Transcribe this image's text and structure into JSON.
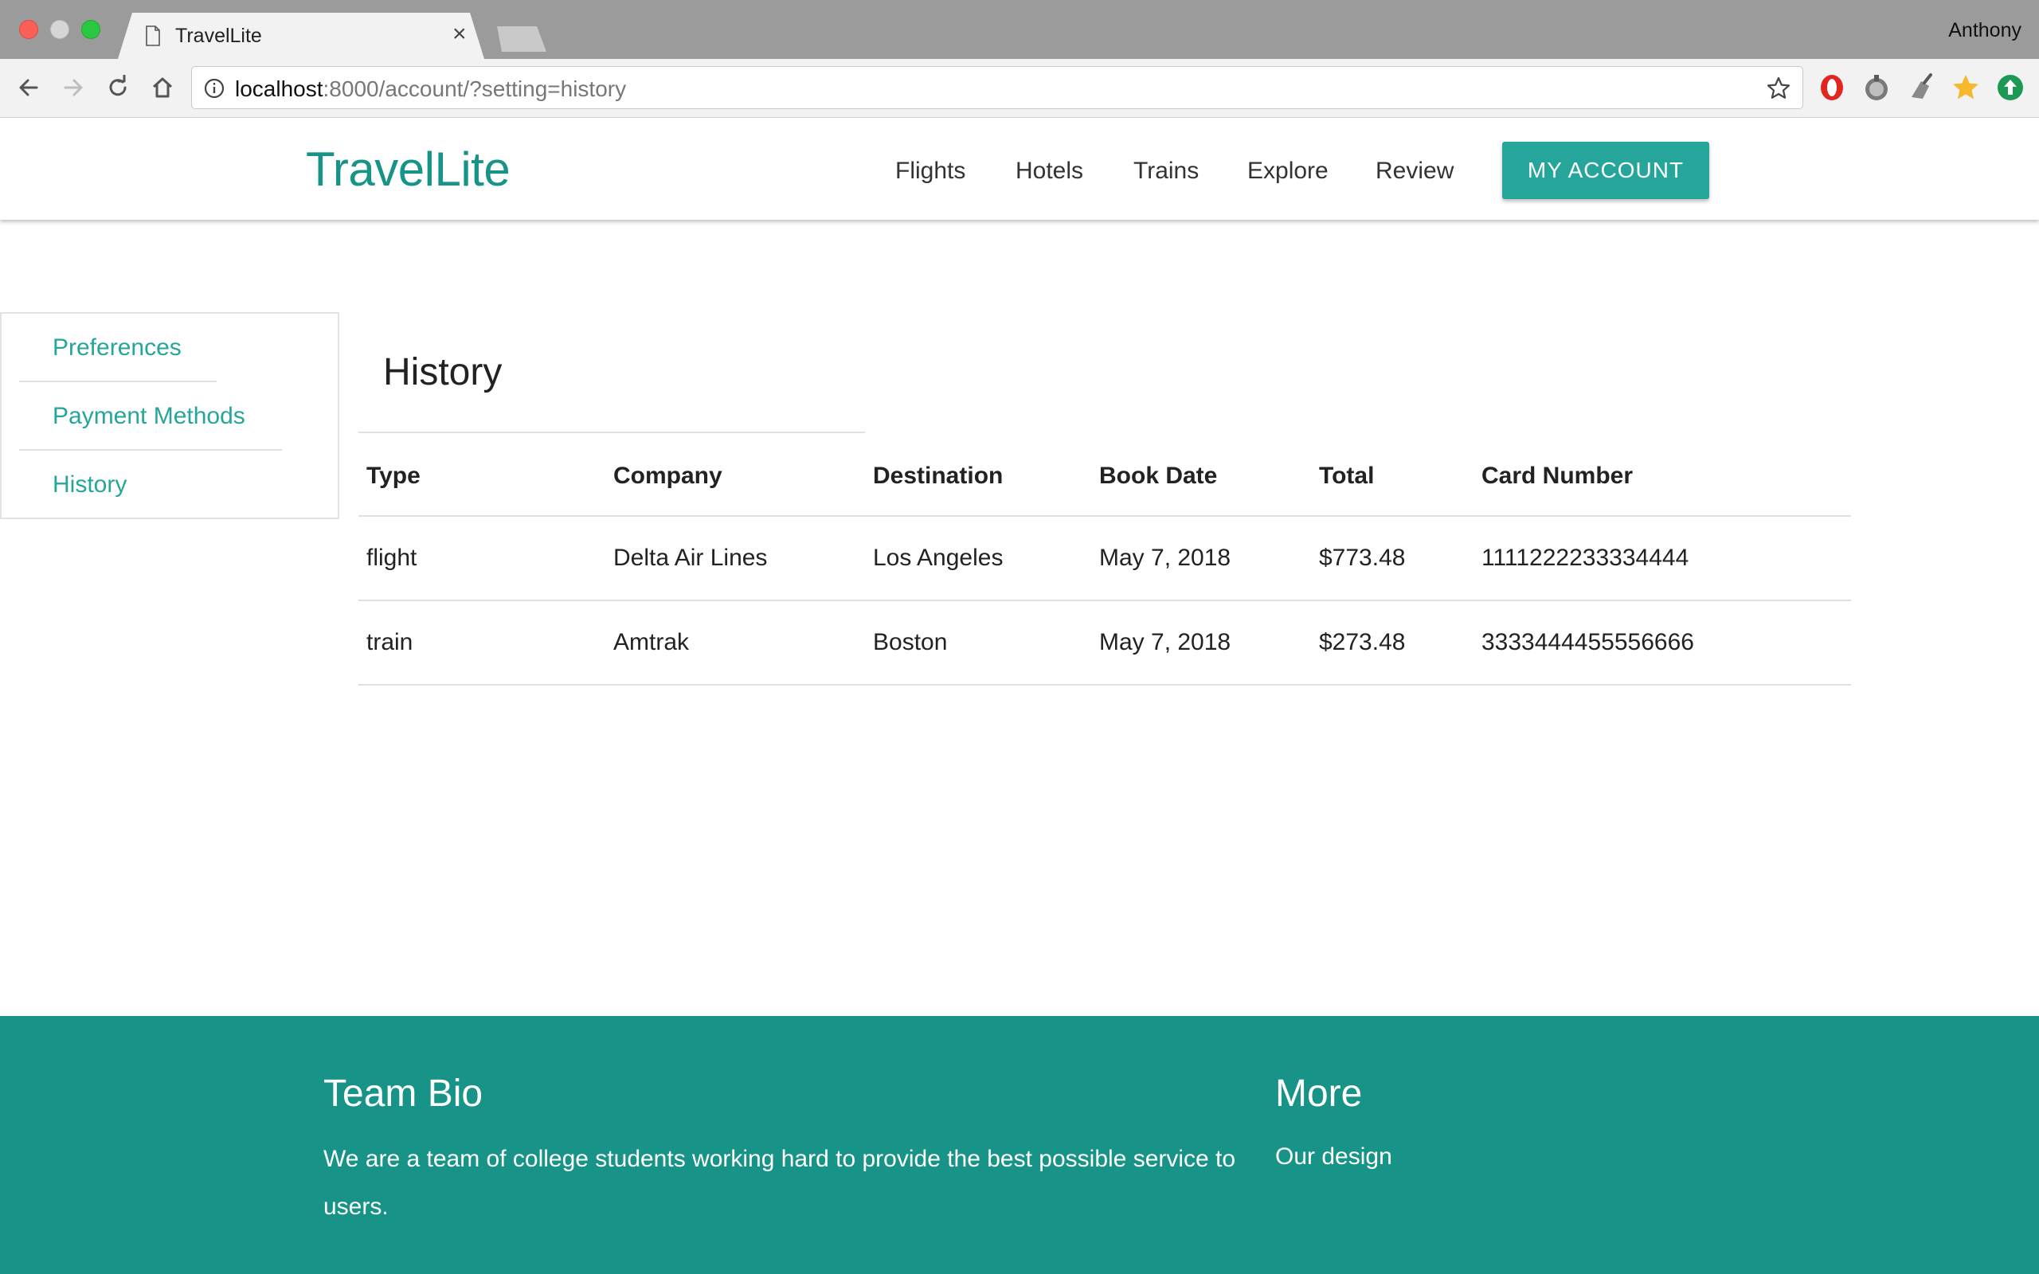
{
  "browser": {
    "tab_title": "TravelLite",
    "tab_close": "×",
    "profile_name": "Anthony",
    "url_host": "localhost",
    "url_rest": ":8000/account/?setting=history"
  },
  "header": {
    "logo": "TravelLite",
    "nav": [
      "Flights",
      "Hotels",
      "Trains",
      "Explore",
      "Review"
    ],
    "account_button": "MY ACCOUNT"
  },
  "sidebar": {
    "items": [
      {
        "label": "Preferences"
      },
      {
        "label": "Payment Methods"
      },
      {
        "label": "History"
      }
    ]
  },
  "main": {
    "title": "History",
    "table": {
      "columns": [
        "Type",
        "Company",
        "Destination",
        "Book Date",
        "Total",
        "Card Number"
      ],
      "rows": [
        [
          "flight",
          "Delta Air Lines",
          "Los Angeles",
          "May 7, 2018",
          "$773.48",
          "1111222233334444"
        ],
        [
          "train",
          "Amtrak",
          "Boston",
          "May 7, 2018",
          "$273.48",
          "3333444455556666"
        ]
      ]
    }
  },
  "footer": {
    "bio_heading": "Team Bio",
    "bio_text": "We are a team of college students working hard to provide the best possible service to users.",
    "more_heading": "More",
    "more_link": "Our design"
  },
  "colors": {
    "brand": "#179487",
    "accent": "#26a69a"
  },
  "icons": {
    "back": "back-arrow-icon",
    "forward": "forward-arrow-icon",
    "reload": "reload-icon",
    "home": "home-icon",
    "info": "info-icon",
    "bookmark": "bookmark-star-icon",
    "extensions": [
      "opera-extension-icon",
      "pocket-extension-icon",
      "broom-extension-icon",
      "star-extension-icon",
      "upload-extension-icon"
    ]
  }
}
